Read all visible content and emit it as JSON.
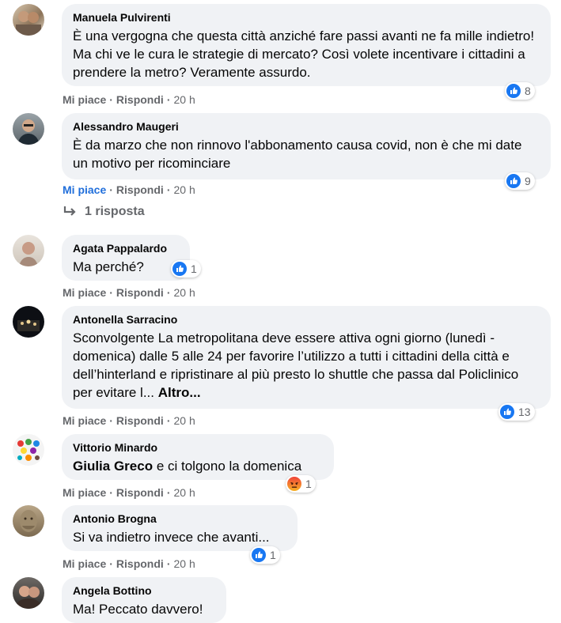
{
  "actions": {
    "like_label": "Mi piace",
    "reply_label": "Rispondi",
    "separator": "·"
  },
  "colors": {
    "bubble": "#f0f2f5",
    "like_blue": "#1877f2",
    "liked_text": "#216fdb",
    "muted_text": "#65676b",
    "angry_orange": "#e9710f"
  },
  "comments": [
    {
      "author": "Manuela Pulvirenti",
      "text": "È una vergogna che questa città anziché fare passi avanti ne fa mille indietro! Ma chi ve le cura le strategie di mercato? Così volete incentivare i cittadini a prendere la metro? Veramente assurdo.",
      "reaction_icon": "like-icon",
      "reaction_count": "8",
      "time": "20 h"
    },
    {
      "author": "Alessandro Maugeri",
      "text": "È da marzo che non rinnovo l'abbonamento causa covid, non è che mi date un motivo per ricominciare",
      "reaction_icon": "like-icon",
      "reaction_count": "9",
      "time": "20 h",
      "liked": true,
      "replies_label": "1 risposta"
    },
    {
      "author": "Agata Pappalardo",
      "text": "Ma perché?",
      "reaction_icon": "like-icon",
      "reaction_count": "1",
      "time": "20 h"
    },
    {
      "author": "Antonella Sarracino",
      "text": "Sconvolgente La metropolitana deve essere attiva ogni giorno (lunedì - domenica) dalle 5 alle 24 per favorire l’utilizzo a tutti i cittadini della città e dell’hinterland e ripristinare al più presto lo shuttle che passa dal Policlinico per evitare l...",
      "more_label": "Altro...",
      "reaction_icon": "like-icon",
      "reaction_count": "13",
      "time": "20 h"
    },
    {
      "author": "Vittorio Minardo",
      "mention": "Giulia Greco",
      "text": " e ci tolgono la domenica",
      "reaction_icon": "angry-icon",
      "reaction_count": "1",
      "time": "20 h"
    },
    {
      "author": "Antonio Brogna",
      "text": "Si va indietro invece che avanti...",
      "reaction_icon": "like-icon",
      "reaction_count": "1",
      "time": "20 h"
    },
    {
      "author": "Angela Bottino",
      "text": "Ma! Peccato davvero!"
    }
  ]
}
